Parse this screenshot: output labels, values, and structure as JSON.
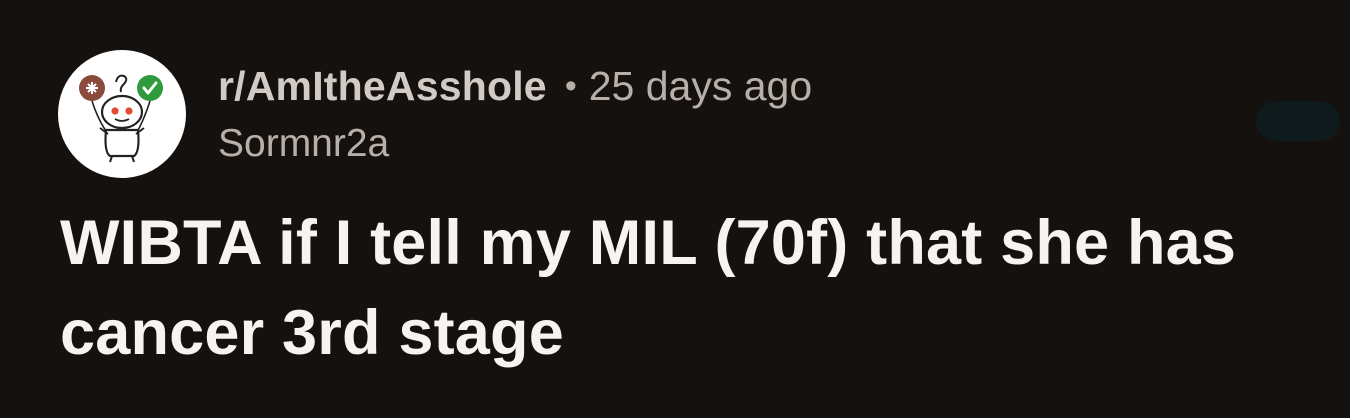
{
  "post": {
    "subreddit": "r/AmItheAsshole",
    "separator": "•",
    "age": "25 days ago",
    "author": "Sormnr2a",
    "title": "WIBTA if I tell my MIL (70f) that she has cancer 3rd stage"
  },
  "icons": {
    "avatar": "snoo-balloons-avatar-icon",
    "overflow": "more-options-button"
  },
  "colors": {
    "background": "#15110f",
    "title": "#f7f3f0",
    "subreddit": "#d2cbc5",
    "meta": "#b7afa8",
    "balloon_left": "#8a4b3d",
    "balloon_right": "#2f9b3d",
    "snoo_eye": "#e24b2f"
  }
}
